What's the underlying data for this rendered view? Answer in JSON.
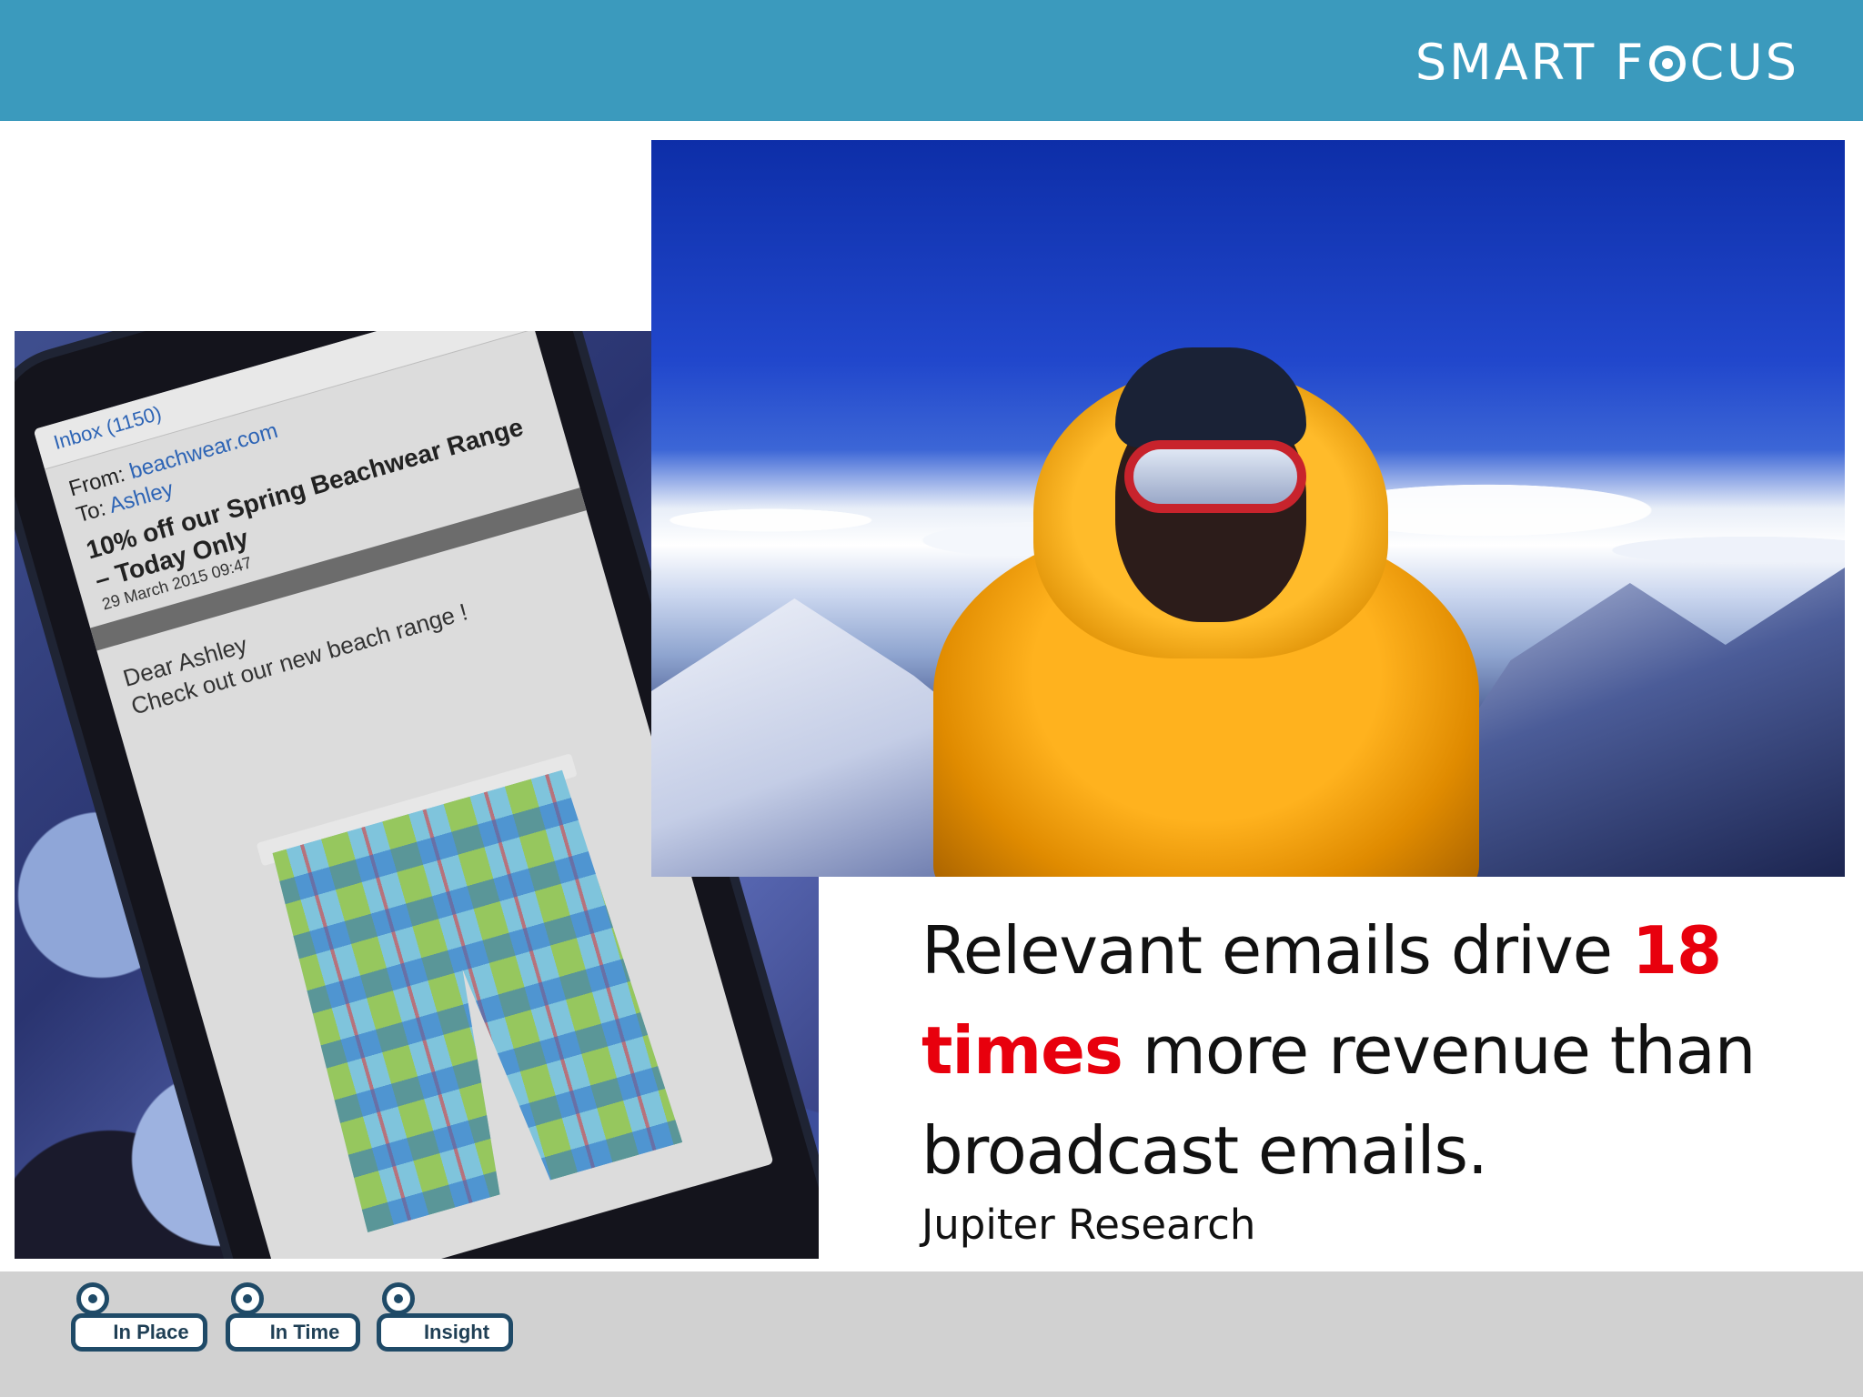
{
  "header": {
    "logo_part1": "SMART F",
    "logo_part2": "CUS",
    "bar_color": "#3b9abd"
  },
  "phone_email": {
    "inbox": "Inbox (1150)",
    "from_label": "From:",
    "from_value": "beachwear.com",
    "to_label": "To:",
    "to_value": "Ashley",
    "subject": "10% off our Spring Beachwear Range – Today Only",
    "date": "29 March 2015 09:47",
    "greeting": "Dear Ashley",
    "body": "Check out our new beach range !"
  },
  "quote": {
    "text_before": "Relevant emails drive ",
    "highlight": "18 times",
    "text_after": " more revenue than broadcast emails.",
    "highlight_color": "#e8000d",
    "attribution": "Jupiter Research"
  },
  "footer": {
    "bar_color": "#d1d1d1",
    "badges": [
      {
        "label": "In Place",
        "icon": "location-pin-icon"
      },
      {
        "label": "In Time",
        "icon": "clock-pin-icon"
      },
      {
        "label": "Insight",
        "icon": "chart-pin-icon"
      }
    ]
  }
}
